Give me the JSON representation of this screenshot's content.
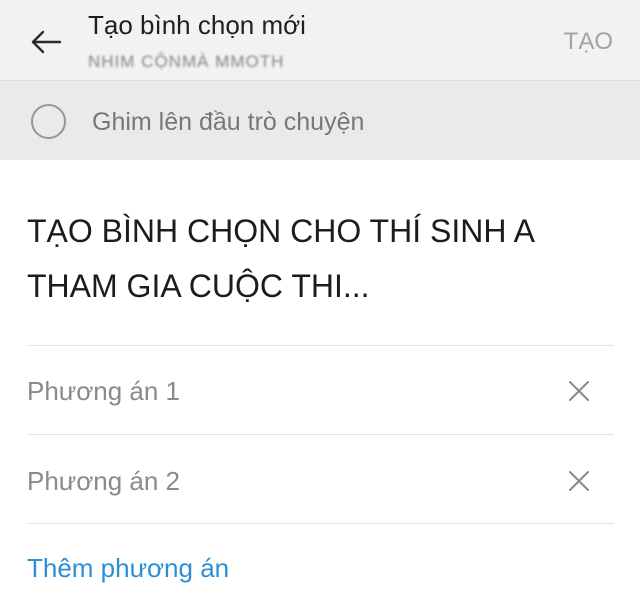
{
  "header": {
    "title": "Tạo bình chọn mới",
    "subtitle": "NHIM CỘNMÀ MMOTH",
    "create_label": "TẠO",
    "back_icon": "arrow-left-icon",
    "background": "#f2f2f2"
  },
  "pin": {
    "label": "Ghim lên đầu trò chuyện",
    "checked": false,
    "background": "#eaeaea"
  },
  "question": {
    "text": "TẠO BÌNH CHỌN CHO THÍ SINH A THAM GIA CUỘC THI..."
  },
  "options": [
    {
      "placeholder": "Phương án 1",
      "remove_icon": "close-icon"
    },
    {
      "placeholder": "Phương án 2",
      "remove_icon": "close-icon"
    }
  ],
  "add_option": {
    "label": "Thêm phương án",
    "color": "#2c8fd6"
  }
}
